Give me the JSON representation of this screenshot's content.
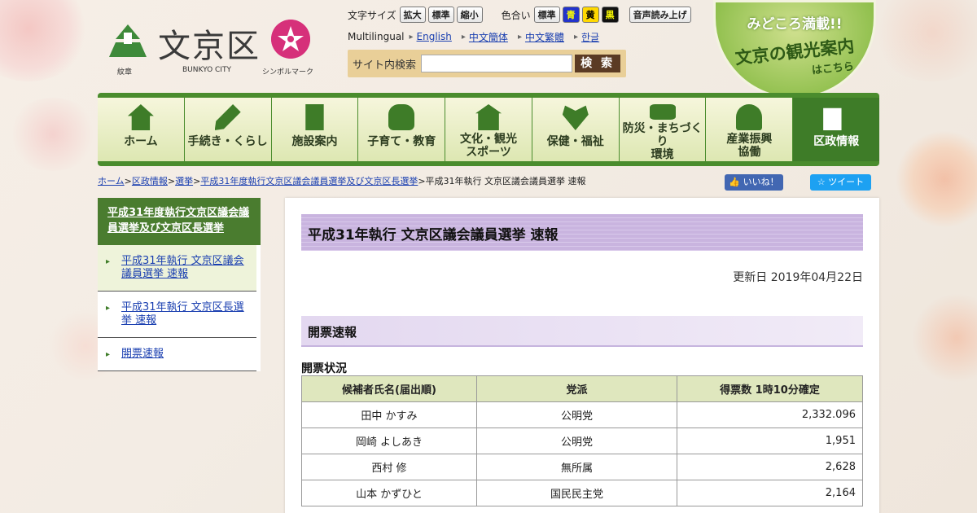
{
  "header": {
    "logo_text": "文京区",
    "logo_caption_left": "紋章",
    "logo_caption_mid": "BUNKYO CITY",
    "logo_caption_right": "シンボルマーク"
  },
  "toolbar": {
    "font_size_label": "文字サイズ",
    "font_buttons": [
      "拡大",
      "標準",
      "縮小"
    ],
    "color_label": "色合い",
    "color_buttons": [
      "標準",
      "青",
      "黄",
      "黒"
    ],
    "read_aloud": "音声読み上げ",
    "multilingual_label": "Multilingual",
    "languages": [
      "English",
      "中文簡体",
      "中文繁體",
      "한글"
    ]
  },
  "search": {
    "label": "サイト内検索",
    "button": "検 索",
    "value": ""
  },
  "banner": {
    "line1": "みどころ満載!!",
    "line2": "文京の観光案内",
    "line3": "はこちら"
  },
  "nav": {
    "items": [
      {
        "label": "ホーム",
        "icon": "house-icon"
      },
      {
        "label": "手続き・くらし",
        "icon": "pencil-icon"
      },
      {
        "label": "施設案内",
        "icon": "building-icon"
      },
      {
        "label": "子育て・教育",
        "icon": "backpack-icon"
      },
      {
        "label": "文化・観光\nスポーツ",
        "icon": "temple-icon"
      },
      {
        "label": "保健・福祉",
        "icon": "heart-hands-icon"
      },
      {
        "label": "防災・まちづくり\n環境",
        "icon": "emergency-kit-icon"
      },
      {
        "label": "産業振興\n協働",
        "icon": "handshake-icon"
      },
      {
        "label": "区政情報",
        "icon": "document-icon"
      }
    ]
  },
  "breadcrumb": {
    "links": [
      "ホーム",
      "区政情報",
      "選挙",
      "平成31年度執行文京区議会議員選挙及び文京区長選挙"
    ],
    "current": "平成31年執行 文京区議会議員選挙 速報"
  },
  "social": {
    "like": "いいね！",
    "tweet": "ツイート"
  },
  "sidebar": {
    "heading": "平成31年度執行文京区議会議員選挙及び文京区長選挙",
    "items": [
      "平成31年執行 文京区議会議員選挙 速報",
      "平成31年執行 文京区長選挙 速報",
      "開票速報"
    ]
  },
  "main": {
    "title": "平成31年執行 文京区議会議員選挙 速報",
    "updated": "更新日 2019年04月22日",
    "section_title": "開票速報",
    "subsection": "開票状況",
    "table": {
      "headers": [
        "候補者氏名(届出順)",
        "党派",
        "得票数 1時10分確定"
      ],
      "rows": [
        [
          "田中 かすみ",
          "公明党",
          "2,332.096"
        ],
        [
          "岡崎 よしあき",
          "公明党",
          "1,951"
        ],
        [
          "西村 修",
          "無所属",
          "2,628"
        ],
        [
          "山本 かずひと",
          "国民民主党",
          "2,164"
        ]
      ]
    }
  }
}
